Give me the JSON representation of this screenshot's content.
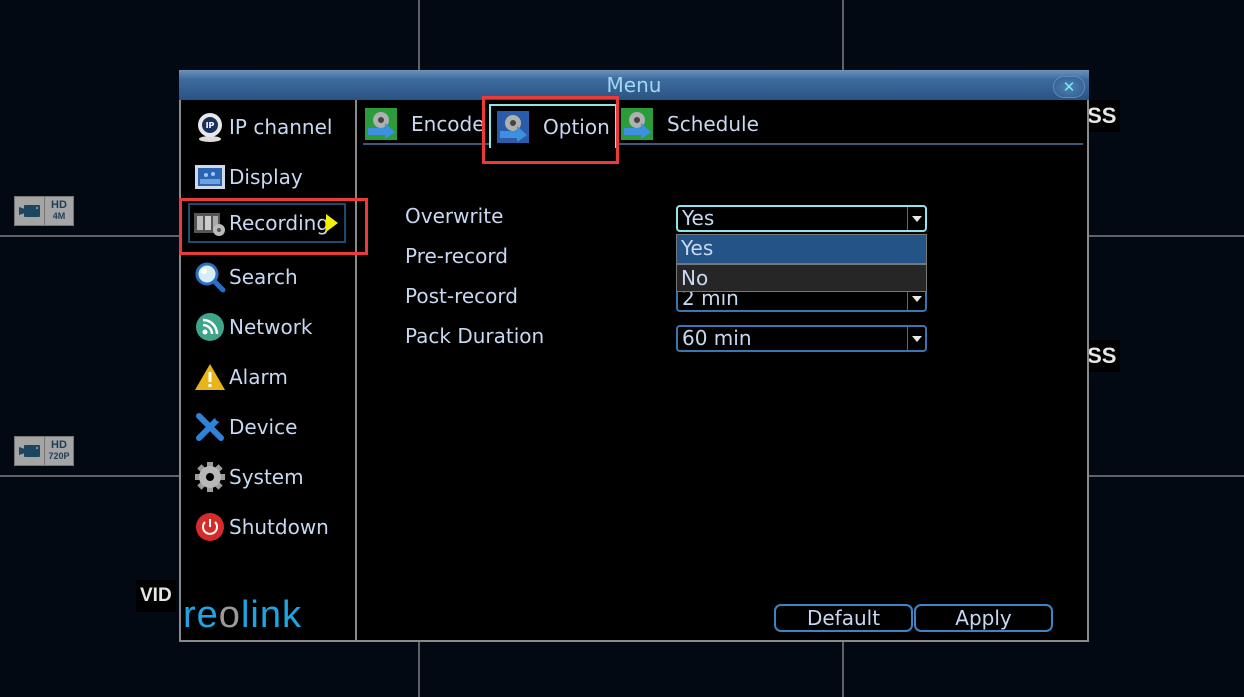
{
  "background": {
    "camera_badges": [
      {
        "line1": "HD",
        "line2": "4M"
      },
      {
        "line1": "HD",
        "line2": "720P"
      }
    ],
    "osd_tags": [
      "OSS",
      "OSS",
      "VID"
    ]
  },
  "menu": {
    "title": "Menu",
    "close_icon": "close-icon",
    "sidebar": {
      "items": [
        {
          "label": "IP channel",
          "icon": "ip-camera-icon"
        },
        {
          "label": "Display",
          "icon": "display-icon"
        },
        {
          "label": "Recording",
          "icon": "recording-icon",
          "active": true
        },
        {
          "label": "Search",
          "icon": "search-icon"
        },
        {
          "label": "Network",
          "icon": "network-icon"
        },
        {
          "label": "Alarm",
          "icon": "alarm-icon"
        },
        {
          "label": "Device",
          "icon": "device-icon"
        },
        {
          "label": "System",
          "icon": "system-icon"
        },
        {
          "label": "Shutdown",
          "icon": "shutdown-icon"
        }
      ],
      "logo": {
        "part1": "re",
        "part2": "o",
        "part3": "link"
      }
    },
    "tabs": [
      {
        "label": "Encode"
      },
      {
        "label": "Option",
        "active": true
      },
      {
        "label": "Schedule"
      }
    ],
    "fields": [
      {
        "label": "Overwrite",
        "value": "Yes"
      },
      {
        "label": "Pre-record",
        "value": ""
      },
      {
        "label": "Post-record",
        "value": "2 min"
      },
      {
        "label": "Pack Duration",
        "value": "60 min"
      }
    ],
    "overwrite_dropdown": {
      "options": [
        "Yes",
        "No"
      ],
      "selected": "Yes"
    },
    "buttons": {
      "default_label": "Default",
      "apply_label": "Apply"
    }
  },
  "colors": {
    "highlight": "#ea3b3b",
    "accent": "#3b84c6",
    "selected_option": "#245487",
    "active_arrow": "#f4f000"
  }
}
